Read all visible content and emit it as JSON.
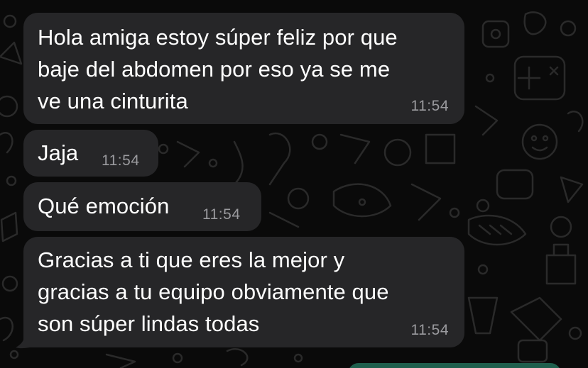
{
  "messages": [
    {
      "text": "Hola amiga estoy súper feliz por que\nbaje del abdomen por eso ya se me\nve una cinturita",
      "time": "11:54"
    },
    {
      "text": "Jaja",
      "time": "11:54"
    },
    {
      "text": "Qué emoción",
      "time": "11:54"
    },
    {
      "text": "Gracias a ti que eres la mejor y\ngracias a tu equipo obviamente que\nson súper lindas todas",
      "time": "11:54"
    }
  ],
  "colors": {
    "background": "#0a0a0a",
    "incoming_bubble": "#262628",
    "timestamp": "#9a9a9e",
    "outgoing_bubble": "#1f5f4d"
  }
}
